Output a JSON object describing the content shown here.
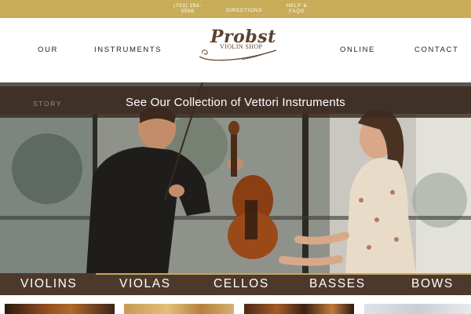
{
  "topbar": {
    "phone": "(703) 256-0566",
    "directions": "DIRECTIONS",
    "help": "HELP & FAQS"
  },
  "nav": {
    "our": "OUR",
    "instruments": "INSTRUMENTS",
    "online": "ONLINE",
    "contact": "CONTACT",
    "story": "STORY"
  },
  "logo": {
    "name": "Probst",
    "sub": "VIOLIN SHOP"
  },
  "hero": {
    "title": "See Our Collection of Vettori Instruments"
  },
  "categories": [
    "VIOLINS",
    "VIOLAS",
    "CELLOS",
    "BASSES",
    "BOWS"
  ],
  "colors": {
    "gold": "#c7ab55",
    "brown": "#3e281a",
    "accent": "#c8a55a"
  }
}
